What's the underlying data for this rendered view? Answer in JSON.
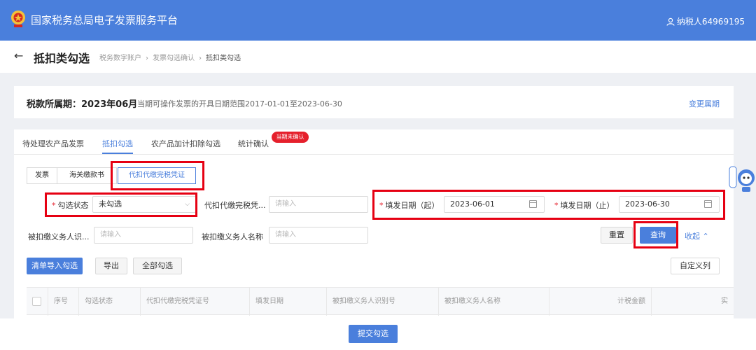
{
  "header": {
    "app_title": "国家税务总局电子发票服务平台",
    "user": "纳税人64969195",
    "logo_icon": "tax-emblem",
    "user_icon": "user-icon",
    "bar_color": "#4a7fdc"
  },
  "page": {
    "title": "抵扣类勾选",
    "breadcrumb": [
      "税务数字账户",
      "发票勾选确认",
      "抵扣类勾选"
    ]
  },
  "period": {
    "label": "税款所属期：2023年06月",
    "range": "当期可操作发票的开具日期范围2017-01-01至2023-06-30",
    "change_link": "变更属期"
  },
  "tabs": [
    {
      "label": "待处理农产品发票"
    },
    {
      "label": "抵扣勾选",
      "active": true
    },
    {
      "label": "农产品加计扣除勾选"
    },
    {
      "label": "统计确认"
    }
  ],
  "tab_badge": "当期未确认",
  "subtabs": [
    {
      "label": "发票"
    },
    {
      "label": "海关缴款书"
    },
    {
      "label": "代扣代缴完税凭证",
      "active": true
    }
  ],
  "filters": {
    "status": {
      "label": "勾选状态",
      "value": "未勾选"
    },
    "voucher_no": {
      "label": "代扣代缴完税凭...",
      "placeholder": "请输入"
    },
    "date_from": {
      "label": "填发日期（起）",
      "value": "2023-06-01"
    },
    "date_to": {
      "label": "填发日期（止）",
      "value": "2023-06-30"
    },
    "withholder_id": {
      "label": "被扣缴义务人识...",
      "placeholder": "请输入"
    },
    "withholder_name": {
      "label": "被扣缴义务人名称",
      "placeholder": "请输入"
    }
  },
  "buttons": {
    "reset": "重置",
    "query": "查询",
    "collapse": "收起",
    "import": "清单导入勾选",
    "export": "导出",
    "select_all": "全部勾选",
    "custom_columns": "自定义列",
    "submit": "提交勾选"
  },
  "table": {
    "columns": [
      "序号",
      "勾选状态",
      "代扣代缴完税凭证号",
      "填发日期",
      "被扣缴义务人识别号",
      "被扣缴义务人名称",
      "计税金额",
      "实"
    ]
  }
}
